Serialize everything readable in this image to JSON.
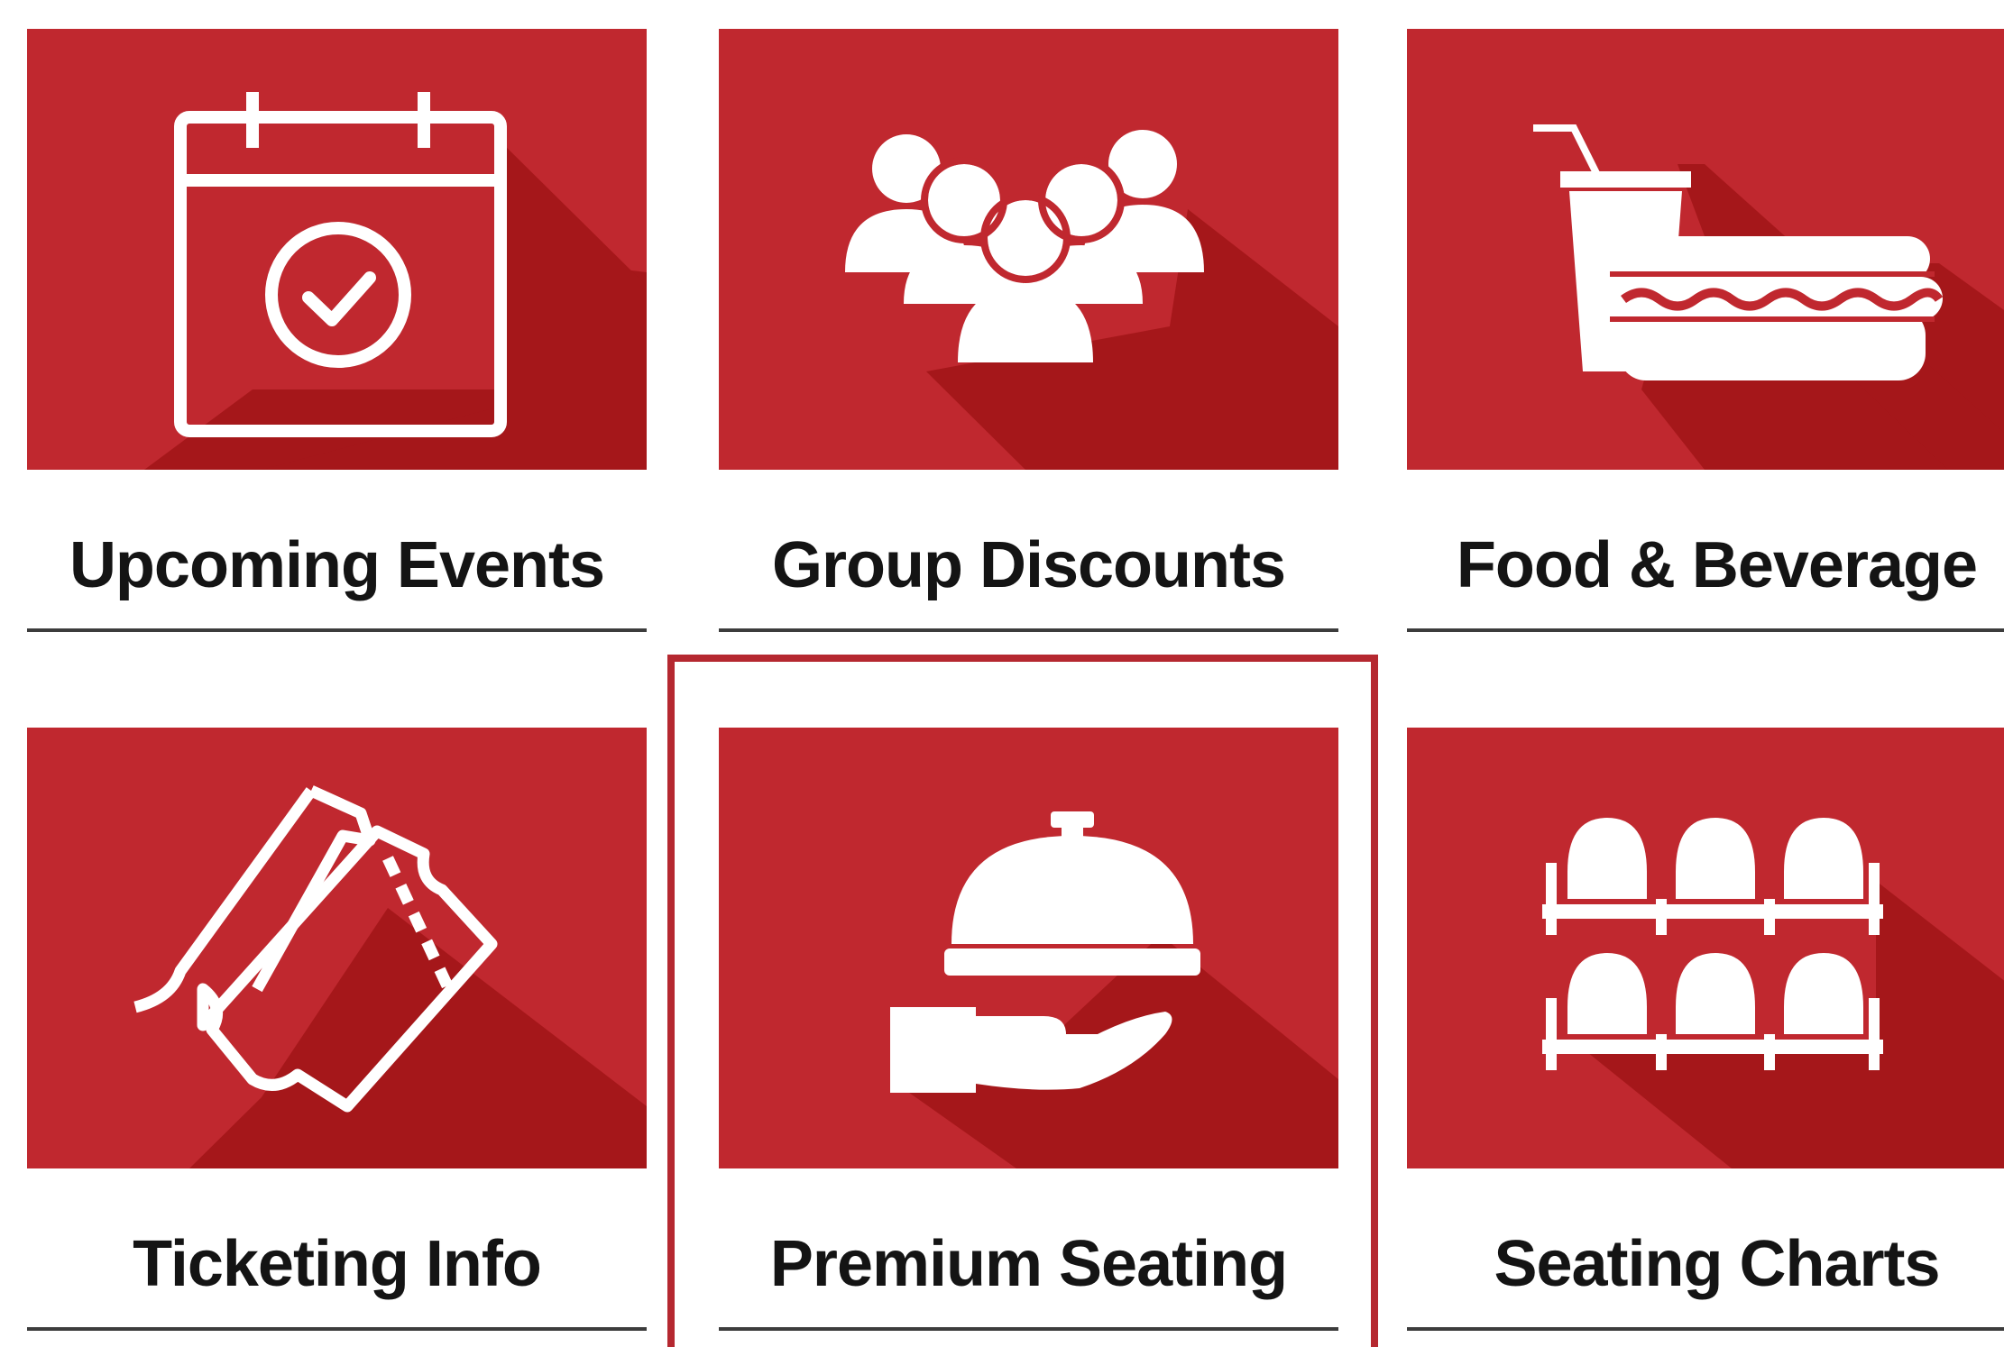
{
  "colors": {
    "tile_background": "#c0282f",
    "tile_shadow": "#a5171a",
    "icon": "#ffffff",
    "label_text": "#141414",
    "underline": "#3c3c3c",
    "selection_border": "#b52830"
  },
  "tiles": [
    {
      "label": "Upcoming Events",
      "icon": "calendar-check-icon"
    },
    {
      "label": "Group Discounts",
      "icon": "group-people-icon"
    },
    {
      "label": "Food & Beverage",
      "icon": "drink-hotdog-icon"
    },
    {
      "label": "Ticketing Info",
      "icon": "tickets-icon"
    },
    {
      "label": "Premium Seating",
      "icon": "serving-cloche-icon",
      "selected": true
    },
    {
      "label": "Seating Charts",
      "icon": "stadium-seats-icon"
    }
  ]
}
